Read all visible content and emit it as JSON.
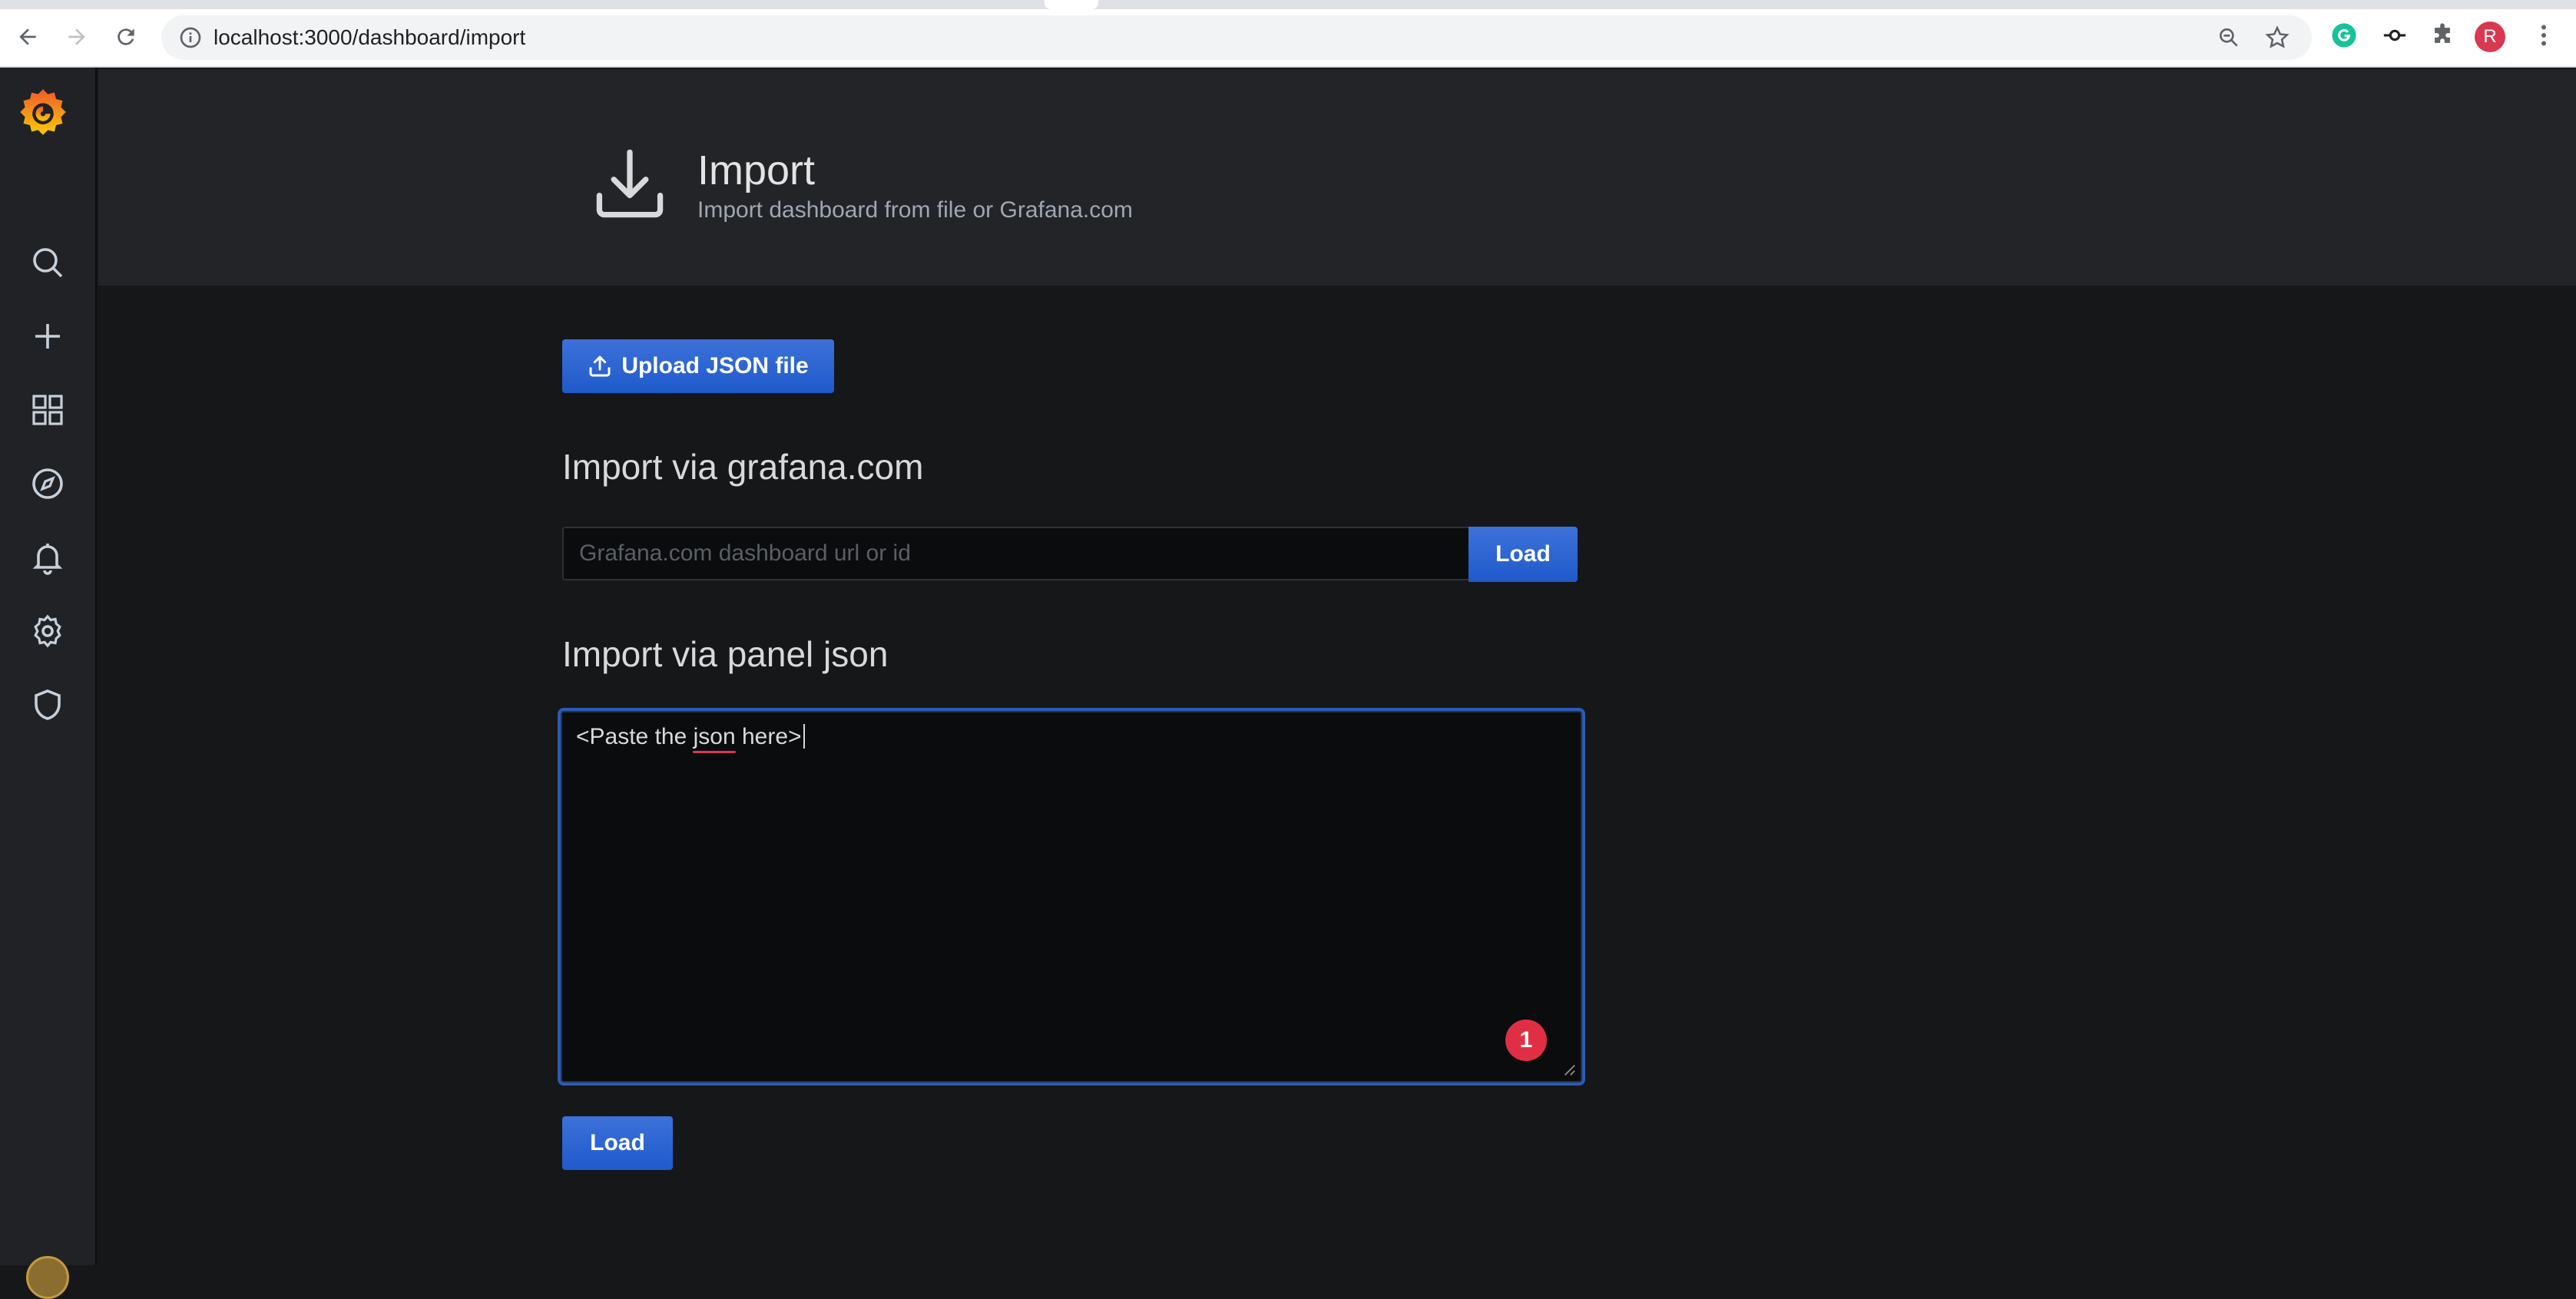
{
  "browser": {
    "url": "localhost:3000/dashboard/import",
    "avatar_initial": "R",
    "icons": [
      "back-icon",
      "forward-icon",
      "reload-icon",
      "info-icon",
      "zoom-icon",
      "star-icon",
      "grammarly-icon",
      "extension-key-icon",
      "puzzle-icon",
      "kebab-menu-icon"
    ]
  },
  "sidebar": {
    "items": [
      {
        "icon": "search-icon"
      },
      {
        "icon": "plus-icon"
      },
      {
        "icon": "dashboards-icon"
      },
      {
        "icon": "explore-icon"
      },
      {
        "icon": "alerting-icon"
      },
      {
        "icon": "settings-icon"
      },
      {
        "icon": "shield-icon"
      }
    ]
  },
  "header": {
    "title": "Import",
    "subtitle": "Import dashboard from file or Grafana.com"
  },
  "upload": {
    "label": "Upload JSON file"
  },
  "grafana_com": {
    "title": "Import via grafana.com",
    "placeholder": "Grafana.com dashboard url or id",
    "value": "",
    "load_label": "Load"
  },
  "panel_json": {
    "title": "Import via panel json",
    "value": "<Paste the json here>",
    "badge_count": "1",
    "load_label": "Load"
  },
  "colors": {
    "primary": "#3d71d9",
    "background": "#161719",
    "sidebar": "#202226",
    "badge": "#e02f44"
  }
}
